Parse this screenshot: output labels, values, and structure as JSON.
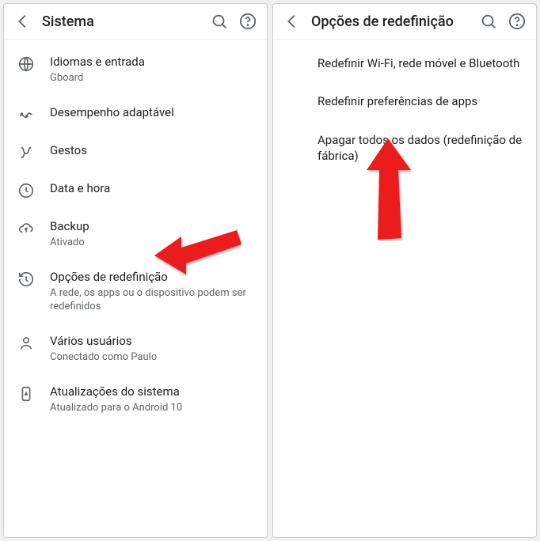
{
  "left": {
    "title": "Sistema",
    "items": [
      {
        "id": "languages",
        "icon": "globe",
        "title": "Idiomas e entrada",
        "subtitle": "Gboard"
      },
      {
        "id": "adaptive",
        "icon": "adaptive",
        "title": "Desempenho adaptável",
        "subtitle": ""
      },
      {
        "id": "gestures",
        "icon": "gesture",
        "title": "Gestos",
        "subtitle": ""
      },
      {
        "id": "datetime",
        "icon": "clock",
        "title": "Data e hora",
        "subtitle": ""
      },
      {
        "id": "backup",
        "icon": "cloud",
        "title": "Backup",
        "subtitle": "Ativado"
      },
      {
        "id": "reset",
        "icon": "restore",
        "title": "Opções de redefinição",
        "subtitle": "A rede, os apps ou o dispositivo podem ser redefinidos"
      },
      {
        "id": "users",
        "icon": "person",
        "title": "Vários usuários",
        "subtitle": "Conectado como Paulo"
      },
      {
        "id": "updates",
        "icon": "update",
        "title": "Atualizações do sistema",
        "subtitle": "Atualizado para o Android 10"
      }
    ]
  },
  "right": {
    "title": "Opções de redefinição",
    "items": [
      {
        "id": "reset-net",
        "title": "Redefinir Wi-Fi, rede móvel e Bluetooth"
      },
      {
        "id": "reset-apps",
        "title": "Redefinir preferências de apps"
      },
      {
        "id": "factory-reset",
        "title": "Apagar todos os dados (redefinição de fábrica)"
      }
    ]
  }
}
